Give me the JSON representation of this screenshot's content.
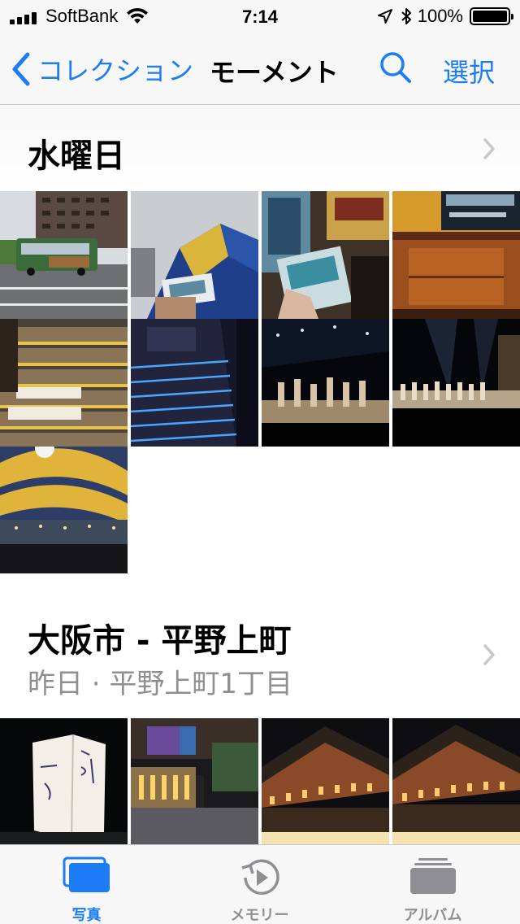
{
  "status": {
    "carrier": "SoftBank",
    "time": "7:14",
    "battery": "100%",
    "battery_level": 1.0
  },
  "nav": {
    "back_label": "コレクション",
    "title": "モーメント",
    "select_label": "選択",
    "accent_color": "#1b7cf5"
  },
  "sections": [
    {
      "title": "水曜日",
      "subtitle": ""
    },
    {
      "title": "大阪市 - 平野上町",
      "subtitle": "昨日 · 平野上町1丁目"
    }
  ],
  "tabs": [
    {
      "label": "写真",
      "icon": "photos-icon",
      "active": true
    },
    {
      "label": "メモリー",
      "icon": "memories-icon",
      "active": false
    },
    {
      "label": "アルバム",
      "icon": "albums-icon",
      "active": false
    }
  ],
  "colors": {
    "active_tab": "#1b7cf5",
    "inactive_tab": "#8e8e93"
  }
}
